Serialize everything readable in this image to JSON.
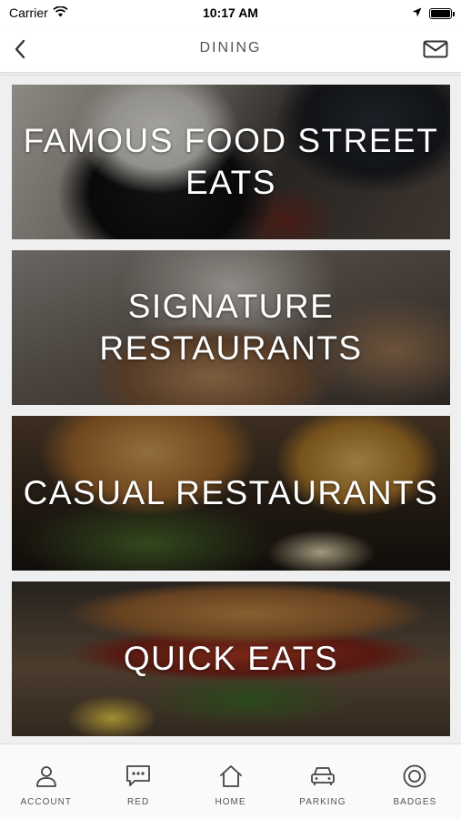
{
  "status_bar": {
    "carrier": "Carrier",
    "time": "10:17 AM",
    "battery_level": 1.0
  },
  "nav": {
    "title": "DINING",
    "back_icon": "chevron-left-icon",
    "mail_icon": "envelope-icon"
  },
  "categories": [
    {
      "label": "FAMOUS FOOD STREET EATS"
    },
    {
      "label": "SIGNATURE RESTAURANTS"
    },
    {
      "label": "CASUAL RESTAURANTS"
    },
    {
      "label": "QUICK EATS"
    }
  ],
  "tabs": [
    {
      "label": "ACCOUNT",
      "icon": "person-icon"
    },
    {
      "label": "RED",
      "icon": "chat-bubble-icon"
    },
    {
      "label": "HOME",
      "icon": "home-icon"
    },
    {
      "label": "PARKING",
      "icon": "car-icon"
    },
    {
      "label": "BADGES",
      "icon": "badge-icon"
    }
  ],
  "colors": {
    "nav_title": "#555555",
    "tab_label": "#555555",
    "content_background": "#efefef"
  }
}
